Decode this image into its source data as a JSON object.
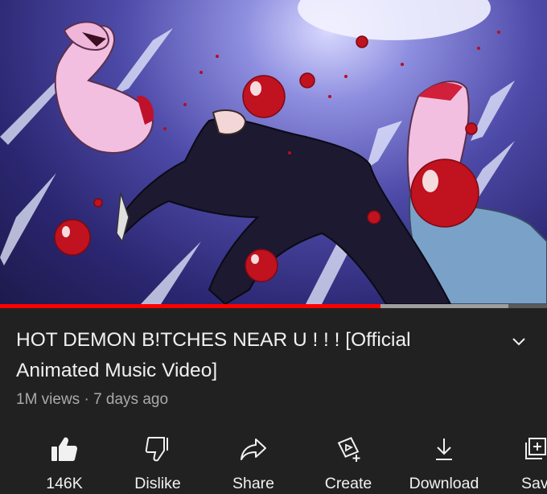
{
  "video": {
    "description_icon": "anime-frame",
    "progress_fraction": 0.695,
    "buffer_fraction": 0.93
  },
  "title": "HOT DEMON B!TCHES NEAR U ! ! ! [Official Animated Music Video]",
  "meta": "1M views · 7 days ago",
  "actions": {
    "like": {
      "label": "146K",
      "icon": "thumbs-up-filled-icon"
    },
    "dislike": {
      "label": "Dislike",
      "icon": "thumbs-down-icon"
    },
    "share": {
      "label": "Share",
      "icon": "share-arrow-icon"
    },
    "create": {
      "label": "Create",
      "icon": "create-sparkle-icon"
    },
    "download": {
      "label": "Download",
      "icon": "download-icon"
    },
    "save": {
      "label": "Save",
      "icon": "add-to-playlist-icon"
    }
  },
  "colors": {
    "background": "#212121",
    "progress_played": "#ff0000",
    "meta_text": "#aaaaaa"
  }
}
